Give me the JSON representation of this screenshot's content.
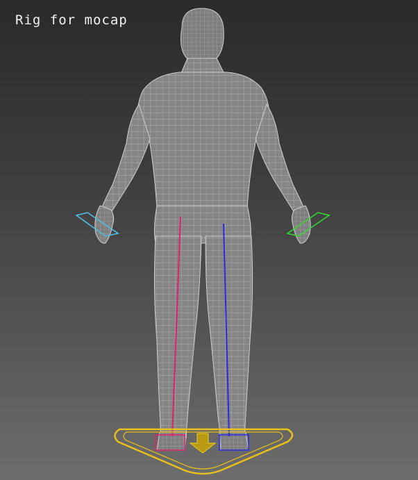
{
  "viewport": {
    "label": "Rig for mocap"
  },
  "colors": {
    "mesh_fill": "#8a8a8a",
    "mesh_edge": "#c8c8c8",
    "left_leg_bone": "#e0226e",
    "right_leg_bone": "#2a2ae0",
    "left_hand_effector": "#4fc3e6",
    "right_hand_effector": "#2ee02e",
    "root_control": "#e8c21a"
  }
}
